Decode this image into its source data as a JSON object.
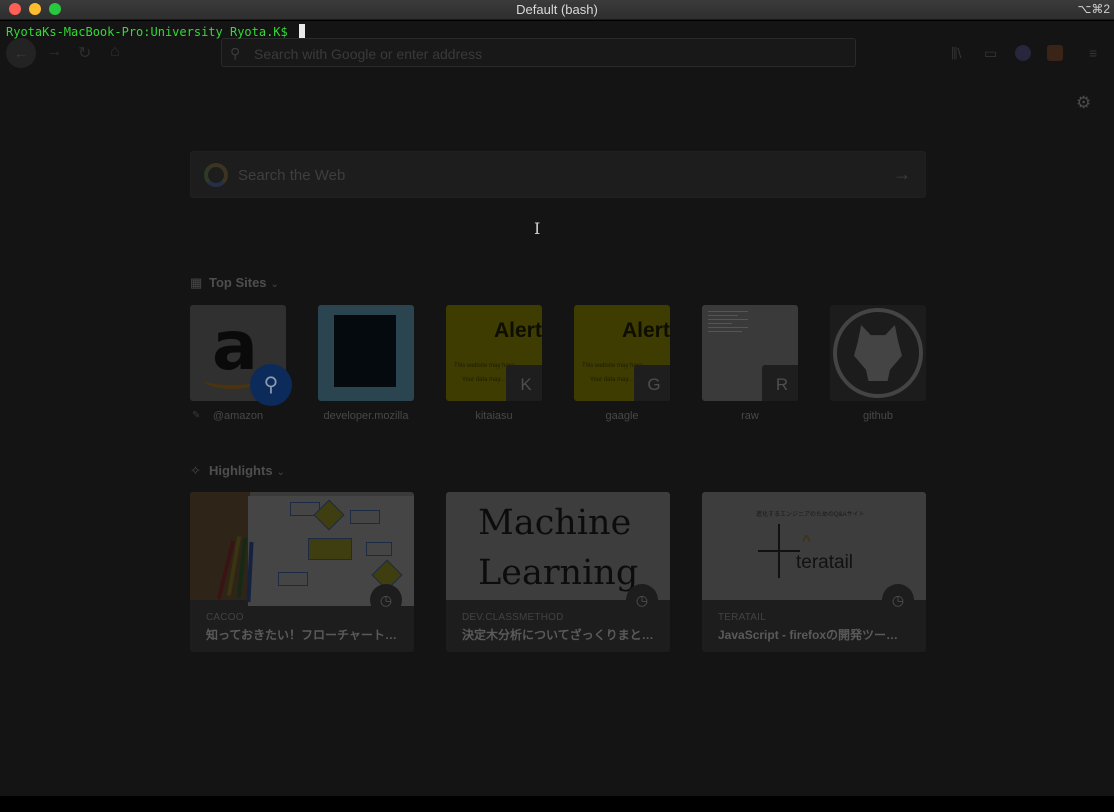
{
  "window": {
    "title": "Default (bash)",
    "shortcut": "⌥⌘2"
  },
  "terminal": {
    "prompt": "RyotaKs-MacBook-Pro:University Ryota.K$ "
  },
  "browser": {
    "toolbar": {
      "back_icon": "←",
      "forward_icon": "→",
      "reload_icon": "↻",
      "home_icon": "⌂",
      "search_icon": "⚲",
      "url_placeholder": "Search with Google or enter address",
      "library_icon": "⫼\\",
      "sidebar_icon": "▭",
      "menu_icon": "≡"
    },
    "newtab": {
      "settings_icon": "⚙",
      "web_search_placeholder": "Search the Web",
      "web_search_arrow": "→",
      "top_sites": {
        "heading": "Top Sites",
        "icon": "▦",
        "chevron": "⌄",
        "tiles": [
          {
            "label": "@amazon",
            "kind": "amazon",
            "logo_letter": "a",
            "badge_icon": "⚲"
          },
          {
            "label": "developer.mozilla",
            "kind": "mdn"
          },
          {
            "label": "kitaiasu",
            "kind": "alert",
            "alert_text": "Alert",
            "line1": "This website may have...",
            "line2": "Your data may...",
            "badge": "K"
          },
          {
            "label": "gaagle",
            "kind": "alert",
            "alert_text": "Alert",
            "line1": "This website may have...",
            "line2": "Your data may...",
            "badge": "G"
          },
          {
            "label": "raw",
            "kind": "raw",
            "badge": "R"
          },
          {
            "label": "github",
            "kind": "github"
          }
        ]
      },
      "highlights": {
        "heading": "Highlights",
        "icon": "✧",
        "chevron": "⌄",
        "cards": [
          {
            "source": "CACOO",
            "title": "知っておきたい！フローチャート…",
            "kind": "cacoo"
          },
          {
            "source": "DEV.CLASSMETHOD",
            "title": "決定木分析についてざっくりまと…",
            "kind": "ml",
            "image_text": "Machine\nLearning"
          },
          {
            "source": "TERATAIL",
            "title": "JavaScript - firefoxの開発ツー…",
            "kind": "teratail",
            "image_tagline": "進化するエンジニアのためのQ&Aサイト",
            "image_word": "teratail"
          }
        ],
        "clock_icon": "◷"
      }
    }
  },
  "colors": {
    "prompt_green": "#33d936",
    "close": "#fe5f57",
    "minimize": "#febc2e",
    "maximize": "#28c840"
  }
}
